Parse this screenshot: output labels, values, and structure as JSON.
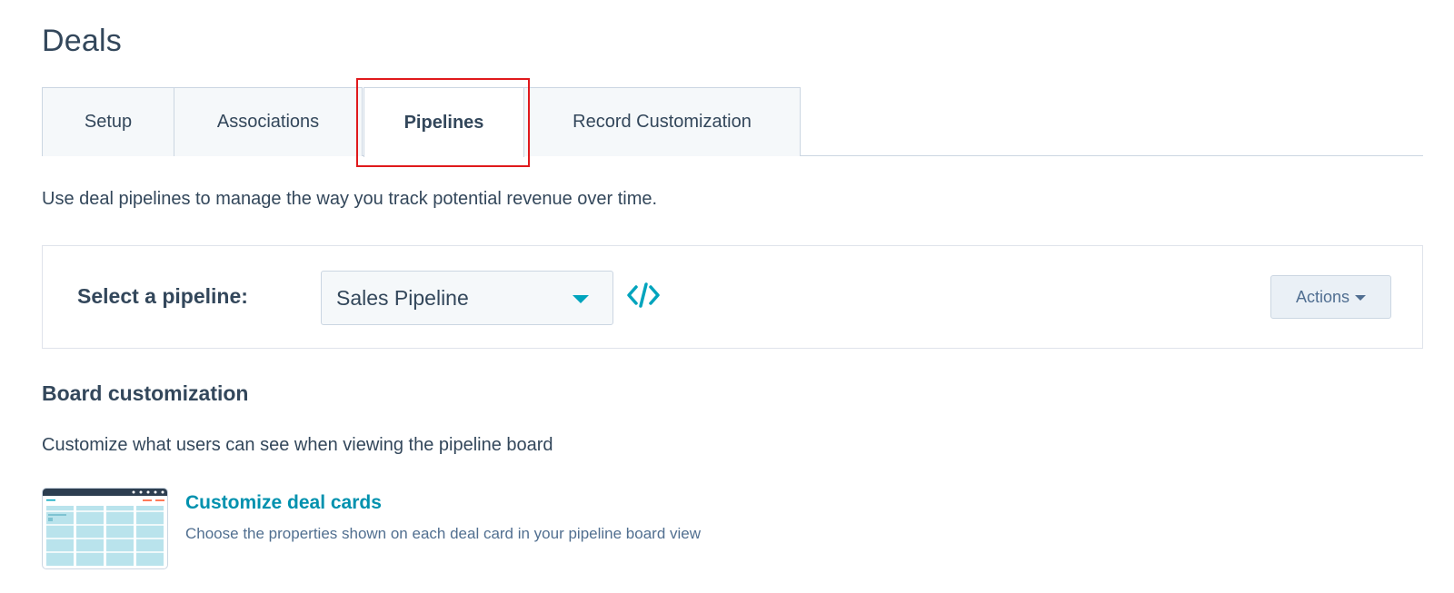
{
  "page": {
    "title": "Deals"
  },
  "tabs": [
    {
      "label": "Setup"
    },
    {
      "label": "Associations"
    },
    {
      "label": "Pipelines"
    },
    {
      "label": "Record Customization"
    }
  ],
  "intro": {
    "text": "Use deal pipelines to manage the way you track potential revenue over time."
  },
  "pipeline": {
    "select_label": "Select a pipeline:",
    "selected_value": "Sales Pipeline",
    "actions_label": "Actions"
  },
  "board": {
    "heading": "Board customization",
    "description": "Customize what users can see when viewing the pipeline board",
    "link_label": "Customize deal cards",
    "link_description": "Choose the properties shown on each deal card in your pipeline board view"
  },
  "colors": {
    "accent": "#00a4bd",
    "link": "#0091ae",
    "text": "#33475b",
    "highlight": "#e0191c"
  },
  "icons": {
    "dropdown": "caret-down-icon",
    "embed": "code-embed-icon",
    "actions": "caret-down-icon",
    "thumbnail": "deal-board-thumbnail"
  }
}
